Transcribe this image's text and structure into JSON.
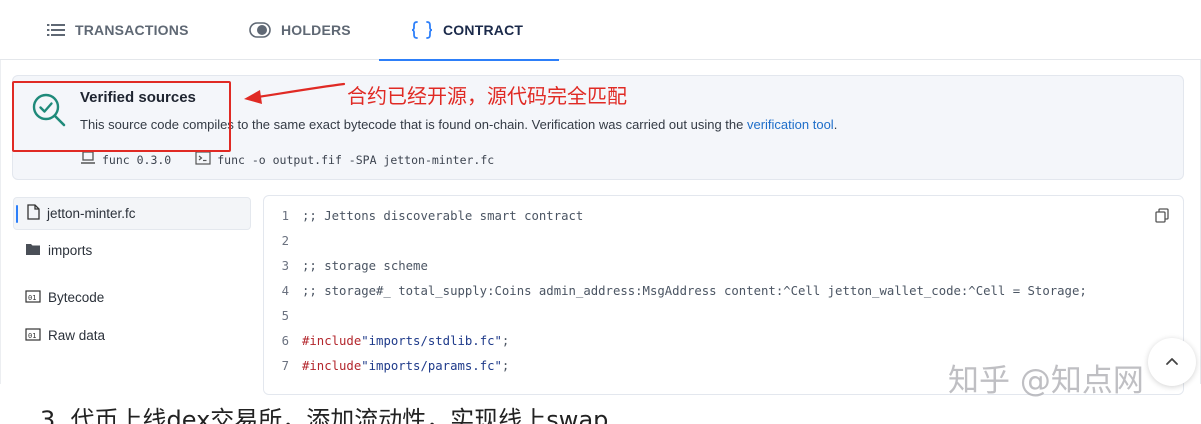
{
  "tabs": [
    {
      "label": "TRANSACTIONS",
      "icon": "list-icon"
    },
    {
      "label": "HOLDERS",
      "icon": "toggle-icon"
    },
    {
      "label": "CONTRACT",
      "icon": "braces-icon",
      "active": true
    }
  ],
  "verified": {
    "title": "Verified sources",
    "description": "This source code compiles to the same exact bytecode that is found on-chain. Verification was carried out using the ",
    "link_text": "verification tool",
    "description_end": ".",
    "compiler": "func 0.3.0",
    "command": "func -o output.fif -SPA jetton-minter.fc",
    "icon": "search-check-icon"
  },
  "annotation": {
    "text": "合约已经开源，源代码完全匹配",
    "color": "#e02a24"
  },
  "sidebar": {
    "items": [
      {
        "label": "jetton-minter.fc",
        "icon": "file-icon",
        "active": true
      },
      {
        "label": "imports",
        "icon": "folder-icon"
      },
      {
        "label": "Bytecode",
        "icon": "binary-icon"
      },
      {
        "label": "Raw data",
        "icon": "binary-icon"
      }
    ]
  },
  "code": {
    "lines": [
      {
        "n": "1",
        "comment": ";; Jettons discoverable smart contract"
      },
      {
        "n": "2"
      },
      {
        "n": "3",
        "comment": ";; storage scheme"
      },
      {
        "n": "4",
        "comment": ";; storage#_ total_supply:Coins admin_address:MsgAddress content:^Cell jetton_wallet_code:^Cell = Storage;"
      },
      {
        "n": "5"
      },
      {
        "n": "6",
        "keyword": "#include",
        "string": "\"imports/stdlib.fc\"",
        "tail": ";"
      },
      {
        "n": "7",
        "keyword": "#include",
        "string": "\"imports/params.fc\"",
        "tail": ";"
      }
    ]
  },
  "watermark": "知乎 @知点网",
  "caption": "3. 代币上线dex交易所，添加流动性，实现线上swap",
  "colors": {
    "accent": "#2d7ff9",
    "link": "#1e6ec9",
    "annotation": "#e02a24"
  }
}
